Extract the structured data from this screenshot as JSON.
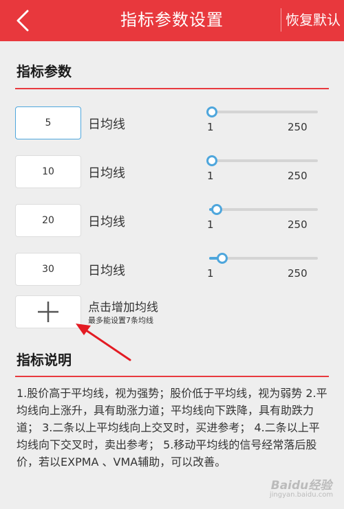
{
  "header": {
    "title": "指标参数设置",
    "restore_label": "恢复默认"
  },
  "params_section": {
    "title": "指标参数"
  },
  "params": [
    {
      "value": "5",
      "label": "日均线",
      "slider_min": "1",
      "slider_max": "250",
      "slider_level": 0.0
    },
    {
      "value": "10",
      "label": "日均线",
      "slider_min": "1",
      "slider_max": "250",
      "slider_level": 0.0
    },
    {
      "value": "20",
      "label": "日均线",
      "slider_min": "1",
      "slider_max": "250",
      "slider_level": 0.05
    },
    {
      "value": "30",
      "label": "日均线",
      "slider_min": "1",
      "slider_max": "250",
      "slider_level": 0.1
    }
  ],
  "add_line": {
    "title": "点击增加均线",
    "subtitle": "最多能设置7条均线"
  },
  "desc_section": {
    "title": "指标说明",
    "text": "1.股价高于平均线，视为强势；股价低于平均线，视为弱势 2.平均线向上涨升，具有助涨力道；平均线向下跌降，具有助跌力道； 3.二条以上平均线向上交叉时，买进参考； 4.二条以上平均线向下交叉时，卖出参考； 5.移动平均线的信号经常落后股价，若以EXPMA 、VMA辅助，可以改善。"
  },
  "watermark": {
    "logo": "Baidu经验",
    "url": "jingyan.baidu.com"
  },
  "colors": {
    "accent_red": "#e8383d",
    "slider_blue": "#4ea6dc"
  },
  "icons": {
    "back": "chevron-left-icon",
    "add": "plus-icon",
    "arrow": "arrow-annotation-icon"
  }
}
